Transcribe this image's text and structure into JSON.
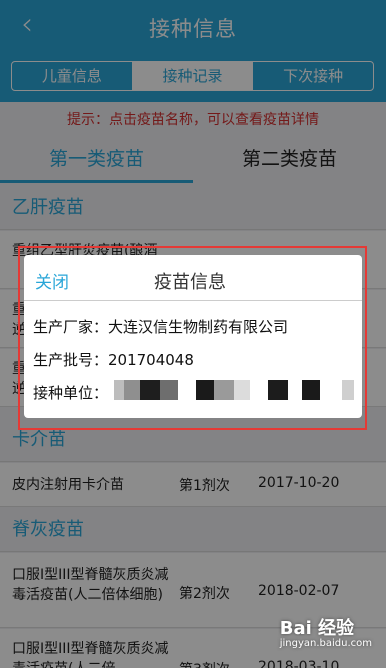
{
  "header": {
    "title": "接种信息",
    "back_icon": "chevron-left-icon"
  },
  "tabs": [
    {
      "label": "儿童信息"
    },
    {
      "label": "接种记录"
    },
    {
      "label": "下次接种"
    }
  ],
  "tip": "提示：点击疫苗名称，可以查看疫苗详情",
  "category_tabs": {
    "first": "第一类疫苗",
    "second": "第二类疫苗"
  },
  "sections": {
    "hepb": "乙肝疫苗",
    "bcg": "卡介苗",
    "polio": "脊灰疫苗"
  },
  "hepb_rows": [
    {
      "name_partial": "重组乙型肝炎疫苗(酿酒"
    },
    {
      "name_partial": "重\n逆"
    },
    {
      "name_partial": "重\n逆"
    }
  ],
  "rows": [
    {
      "name": "皮内注射用卡介苗",
      "dose": "第1剂次",
      "date": "2017-10-20"
    },
    {
      "name": "口服I型III型脊髓灰质炎减毒活疫苗(人二倍体细胞)",
      "dose": "第2剂次",
      "date": "2018-02-07"
    },
    {
      "name": "口服I型III型脊髓灰质炎减毒活疫苗(人二倍",
      "dose": "第3剂次",
      "date": "2018-03-10"
    }
  ],
  "dialog": {
    "close_label": "关闭",
    "title": "疫苗信息",
    "manufacturer": "生产厂家：大连汉信生物制药有限公司",
    "batch": "生产批号：201704048",
    "unit_label": "接种单位："
  },
  "watermark": {
    "brand": "Bai 经验",
    "url": "jingyan.baidu.com"
  },
  "colors": {
    "accent": "#2aa6d8",
    "tip": "#d32f2f",
    "highlight": "#e53935"
  }
}
